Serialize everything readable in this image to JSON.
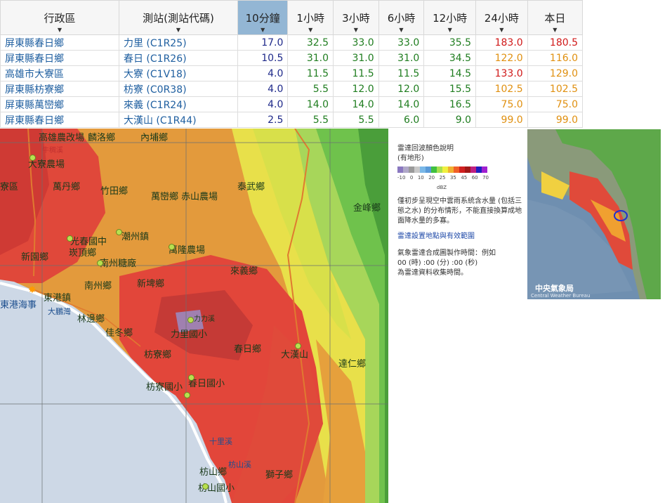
{
  "table": {
    "headers": [
      "行政區",
      "測站(測站代碼)",
      "10分鐘",
      "1小時",
      "3小時",
      "6小時",
      "12小時",
      "24小時",
      "本日"
    ],
    "sort_arrow": "▼",
    "rows": [
      {
        "region": "屏東縣春日鄉",
        "station": "力里 (C1R25)",
        "v10m": "17.0",
        "v1h": "32.5",
        "v3h": "33.0",
        "v6h": "33.0",
        "v12h": "35.5",
        "v24h": "183.0",
        "vday": "180.5"
      },
      {
        "region": "屏東縣春日鄉",
        "station": "春日 (C1R26)",
        "v10m": "10.5",
        "v1h": "31.0",
        "v3h": "31.0",
        "v6h": "31.0",
        "v12h": "34.5",
        "v24h": "122.0",
        "vday": "116.0"
      },
      {
        "region": "高雄市大寮區",
        "station": "大寮 (C1V18)",
        "v10m": "4.0",
        "v1h": "11.5",
        "v3h": "11.5",
        "v6h": "11.5",
        "v12h": "14.5",
        "v24h": "133.0",
        "vday": "129.0"
      },
      {
        "region": "屏東縣枋寮鄉",
        "station": "枋寮 (C0R38)",
        "v10m": "4.0",
        "v1h": "5.5",
        "v3h": "12.0",
        "v6h": "12.0",
        "v12h": "15.5",
        "v24h": "102.5",
        "vday": "102.5"
      },
      {
        "region": "屏東縣萬巒鄉",
        "station": "來義 (C1R24)",
        "v10m": "4.0",
        "v1h": "14.0",
        "v3h": "14.0",
        "v6h": "14.0",
        "v12h": "16.5",
        "v24h": "75.0",
        "vday": "75.0"
      },
      {
        "region": "屏東縣春日鄉",
        "station": "大漢山 (C1R44)",
        "v10m": "2.5",
        "v1h": "5.5",
        "v3h": "5.5",
        "v6h": "6.0",
        "v12h": "9.0",
        "v24h": "99.0",
        "vday": "99.0"
      }
    ]
  },
  "map": {
    "labels": {
      "l1": "高雄農改場",
      "l2": "麟洛鄉",
      "l3": "內埔鄉",
      "l4": "大寮農場",
      "l5": "萬丹鄉",
      "l6": "竹田鄉",
      "l7": "萬巒鄉",
      "l8": "赤山農場",
      "l9": "泰武鄉",
      "l10": "金峰鄉",
      "l11": "光春國中",
      "l12": "潮州鎮",
      "l13": "萬隆農場",
      "l14": "崁頂鄉",
      "l15": "新園鄉",
      "l16": "南州糖廠",
      "l17": "南州鄉",
      "l18": "新埤鄉",
      "l19": "來義鄉",
      "l20": "東港鎮",
      "l21": "東港海事",
      "l22": "大鵬灣",
      "l23": "林邊鄉",
      "l24": "佳冬鄉",
      "l25": "力力溪",
      "l26": "力里國小",
      "l27": "春日鄉",
      "l28": "大漢山",
      "l29": "達仁鄉",
      "l30": "枋寮鄉",
      "l31": "枋寮國小",
      "l32": "春日國小",
      "l33": "十里溪",
      "l34": "枋山溪",
      "l35": "枋山鄉",
      "l36": "枋山國小",
      "l37": "獅子鄉",
      "l38": "寮區",
      "l39": "牛稠溪"
    }
  },
  "legend": {
    "title": "雷達回波顏色說明",
    "subtitle": "(有地形)",
    "ticks": [
      "-10",
      "0",
      "10",
      "20",
      "25",
      "35",
      "45",
      "60",
      "70"
    ],
    "unit": "dBZ",
    "note": "僅初步呈現空中雲雨系統含水量 (包括三態之水) 的分布情形，不能直接換算成地面降水量的多寡。",
    "link": "雷達設置地點與有效範圍",
    "desc1": "氣象雷達合成圖製作時間：例如",
    "desc2": "00 (時) :00 (分) :00 (秒)",
    "desc3": "為雷達資料收集時間。"
  },
  "thumbnail": {
    "logo_text": "中央氣象局",
    "logo_en": "Central Weather Bureau"
  }
}
